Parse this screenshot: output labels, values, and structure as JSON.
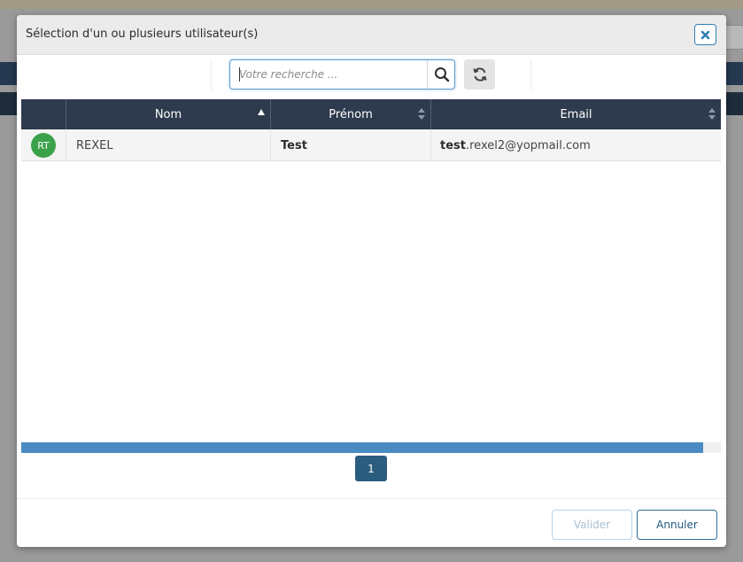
{
  "modal": {
    "title": "Sélection d'un ou plusieurs utilisateur(s)"
  },
  "search": {
    "placeholder": "Votre recherche ...",
    "value": ""
  },
  "icons": {
    "close": "close-icon",
    "search": "search-icon",
    "refresh": "refresh-icon"
  },
  "table": {
    "columns": [
      {
        "label": "",
        "sort": "none"
      },
      {
        "label": "Nom",
        "sort": "ascending"
      },
      {
        "label": "Prénom",
        "sort": "sortable"
      },
      {
        "label": "Email",
        "sort": "sortable"
      }
    ],
    "rows": [
      {
        "initials": "RT",
        "nom": "REXEL",
        "prenom": "Test",
        "email_match": "test",
        "email_rest": ".rexel2@yopmail.com"
      }
    ]
  },
  "pagination": {
    "current_page": "1"
  },
  "footer": {
    "validate_label": "Valider",
    "cancel_label": "Annuler"
  },
  "colors": {
    "header_bg": "#2e3a4d",
    "accent": "#2f7fb5",
    "avatar": "#3aa24a",
    "page_active": "#2b5d7e"
  }
}
